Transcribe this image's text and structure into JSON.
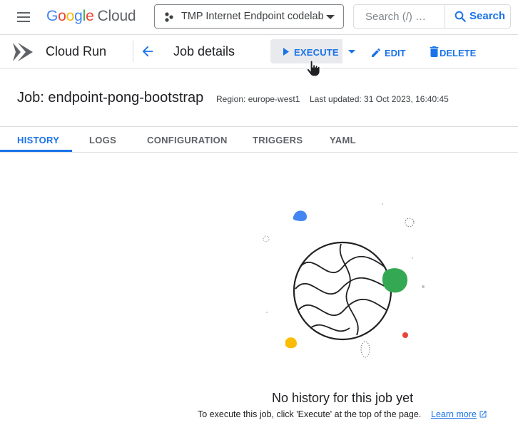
{
  "header": {
    "logo_letters": [
      "G",
      "o",
      "o",
      "g",
      "l",
      "e"
    ],
    "logo_suffix": "Cloud",
    "project_name": "TMP Internet Endpoint codelab",
    "search_placeholder": "Search (/) …",
    "search_button": "Search"
  },
  "product_bar": {
    "product_name": "Cloud Run",
    "page_title": "Job details",
    "execute_label": "EXECUTE",
    "edit_label": "EDIT",
    "delete_label": "DELETE"
  },
  "job": {
    "title": "Job: endpoint-pong-bootstrap",
    "region": "Region: europe-west1",
    "last_updated": "Last updated: 31 Oct 2023, 16:40:45"
  },
  "tabs": [
    {
      "label": "HISTORY",
      "active": true
    },
    {
      "label": "LOGS",
      "active": false
    },
    {
      "label": "CONFIGURATION",
      "active": false
    },
    {
      "label": "TRIGGERS",
      "active": false
    },
    {
      "label": "YAML",
      "active": false
    }
  ],
  "empty_state": {
    "title": "No history for this job yet",
    "subtitle": "To execute this job, click 'Execute' at the top of the page.",
    "learn_more": "Learn more"
  },
  "colors": {
    "accent": "#1a73e8",
    "blue_blob": "#4285f4",
    "green_blob": "#34a853",
    "yellow_blob": "#fbbc04",
    "red_dot": "#ea4335"
  },
  "icons": {
    "menu": "hamburger-icon",
    "project": "project-icon",
    "search": "search-icon",
    "product": "cloud-run-icon",
    "back": "arrow-back-icon",
    "execute": "play-icon",
    "edit": "pencil-icon",
    "delete": "trash-icon",
    "external": "open-in-new-icon"
  }
}
